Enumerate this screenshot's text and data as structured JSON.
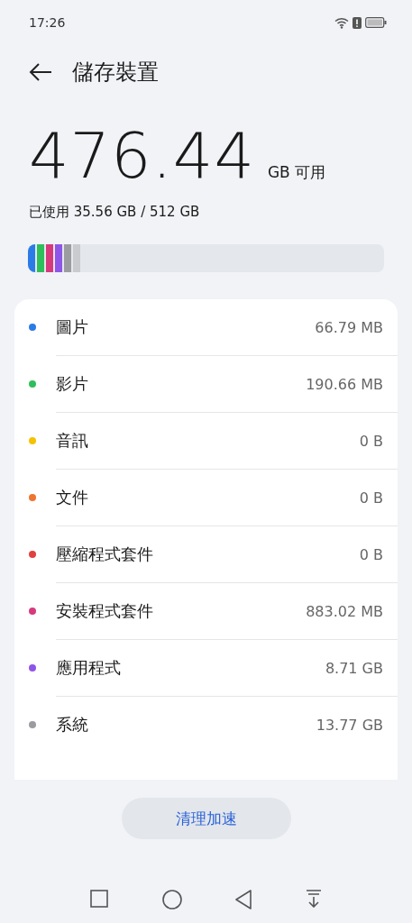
{
  "status_bar": {
    "time": "17:26"
  },
  "header": {
    "title": "儲存裝置"
  },
  "summary": {
    "available": "476.44",
    "available_unit": "GB 可用",
    "used": "已使用 35.56 GB / 512 GB"
  },
  "usage_bar": {
    "segments": [
      {
        "color": "#2a7be6"
      },
      {
        "color": "#2fbf5a"
      },
      {
        "color": "#d63a7d"
      },
      {
        "color": "#8f55e6"
      },
      {
        "color": "#9a9c9f"
      },
      {
        "color": "#c9cbce"
      }
    ]
  },
  "categories": [
    {
      "name": "圖片",
      "size": "66.79 MB",
      "color": "#2a7be6"
    },
    {
      "name": "影片",
      "size": "190.66 MB",
      "color": "#2fbf5a"
    },
    {
      "name": "音訊",
      "size": "0 B",
      "color": "#f5c200"
    },
    {
      "name": "文件",
      "size": "0 B",
      "color": "#ee7430"
    },
    {
      "name": "壓縮程式套件",
      "size": "0 B",
      "color": "#e04141"
    },
    {
      "name": "安裝程式套件",
      "size": "883.02 MB",
      "color": "#d63a7d"
    },
    {
      "name": "應用程式",
      "size": "8.71 GB",
      "color": "#8f55e6"
    },
    {
      "name": "系統",
      "size": "13.77 GB",
      "color": "#9a9c9f"
    }
  ],
  "action_button": {
    "label": "清理加速"
  }
}
